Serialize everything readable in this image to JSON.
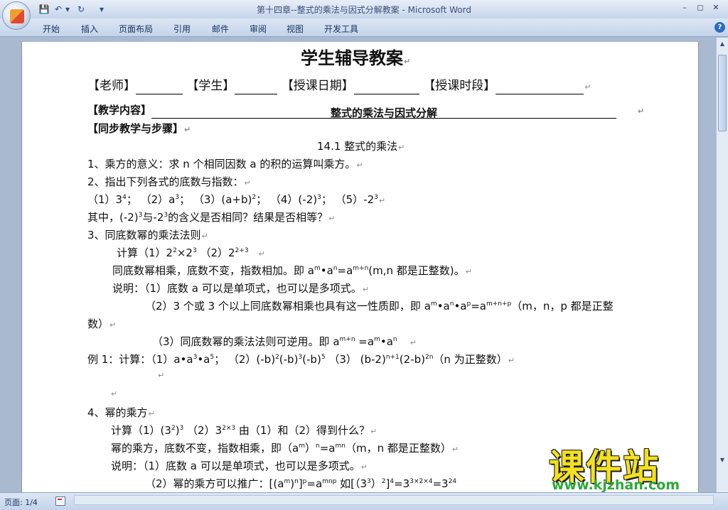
{
  "window": {
    "title": "第十四章--整式的乘法与因式分解教案 - Microsoft Word",
    "minimize": "–",
    "restore": "◻",
    "close": "✕"
  },
  "quick_access": {
    "save_icon": "💾",
    "undo_icon": "↶",
    "undo_dropdown": "▾",
    "redo_icon": "↻",
    "customize_icon": "▾"
  },
  "ribbon": {
    "tabs": [
      "开始",
      "插入",
      "页面布局",
      "引用",
      "邮件",
      "审阅",
      "视图",
      "开发工具"
    ],
    "help": "?"
  },
  "document": {
    "heading": "学生辅导教案",
    "header_fields": {
      "teacher": "【老师】",
      "student": "【学生】",
      "date": "【授课日期】",
      "period": "【授课时段】"
    },
    "content_label": "【教学内容】",
    "content_title": "整式的乘法与因式分解",
    "sync_label": "【同步教学与步骤】",
    "section_title": "14.1  整式的乘法",
    "para_mark": "↵",
    "lines": {
      "l1": "1、乘方的意义：求 n 个相同因数 a 的积的运算叫乘方。",
      "l2": "2、指出下列各式的底数与指数：",
      "l3_1": "（1）3",
      "l3_1s": "4",
      "l3_2": "；  （2）a",
      "l3_2s": "3",
      "l3_3": "；    （3）(a+b)",
      "l3_3s": "2",
      "l3_4": "；    （4）(-2)",
      "l3_4s": "3",
      "l3_5": "；    （5）-2",
      "l3_5s": "3",
      "l4a": "其中，(-2)",
      "l4as": "3",
      "l4b": "与-2",
      "l4bs": "3",
      "l4c": "的含义是否相同？结果是否相等？",
      "l5": "3、同底数幂的乘法法则",
      "l6a": "计算（1）2",
      "l6as": "2",
      "l6b": "×2",
      "l6bs": "3",
      "l6c": "    （2）2",
      "l6cs": "2+3",
      "l7a": "同底数幂相乘，底数不变，指数相加。即 a",
      "l7as": "m",
      "l7b": "•a",
      "l7bs": "n",
      "l7c": "=a",
      "l7cs": "m+n",
      "l7d": "(m,n 都是正整数)。",
      "l8": "说明：（1）底数 a 可以是单项式，也可以是多项式。",
      "l9a": "（2）3 个或 3 个以上同底数幂相乘也具有这一性质即，即 a",
      "l9as": "m",
      "l9b": "•a",
      "l9bs": "n",
      "l9c": "•a",
      "l9cs": "p",
      "l9d": "=a",
      "l9ds": "m+n+p",
      "l9e": "（m，n，p 都是正整",
      "l10": "数）",
      "l11a": "（3）同底数幂的乘法法则可逆用。即 a",
      "l11as": "m+n",
      "l11b": " =a",
      "l11bs": "m",
      "l11c": "•a",
      "l11cs": "n",
      "l12a": "例 1：计算：（1）a•a",
      "l12as": "3",
      "l12b": "•a",
      "l12bs": "5",
      "l12c": "；  （2）(-b)",
      "l12cs": "2",
      "l12d": "(-b)",
      "l12ds": "3",
      "l12e": "(-b)",
      "l12es": "5",
      "l12f": "  （3）  (b-2)",
      "l12fs": "n+1",
      "l12g": "(2-b)",
      "l12gs": "2n",
      "l12h": "（n 为正整数）",
      "l13": "4、幂的乘方",
      "l14a": "计算（1）(3",
      "l14as": "2",
      "l14b": ")",
      "l14bs": "3",
      "l14c": "    （2）3",
      "l14cs": "2×3",
      "l14d": "   由（1）和（2）得到什么？",
      "l15a": "幂的乘方，底数不变，指数相乘，即（a",
      "l15as": "m",
      "l15b": "）",
      "l15bs": "n",
      "l15c": "=a",
      "l15cs": "mn",
      "l15d": "（m，n 都是正整数）",
      "l16": "说明：（1）底数 a 可以是单项式，也可以是多项式。",
      "l17a": "（2）幂的乘方可以推广：[(a",
      "l17as": "m",
      "l17b": ")",
      "l17bs": "n",
      "l17c": "]",
      "l17cs": "p",
      "l17d": "=a",
      "l17ds": "mnp",
      "l17e": "   如[（3",
      "l17es": "3",
      "l17f": "）",
      "l17fs": "2",
      "l17g": "]",
      "l17gs": "4",
      "l17h": "=3",
      "l17hs": "3×2×4",
      "l17i": "=3",
      "l17is": "24"
    }
  },
  "status": {
    "page": "页面: 1/4"
  },
  "watermark": {
    "big": "课件站",
    "url": "www.kjzhan.com"
  },
  "colors": {
    "watermark_yellow": "#f3e11f",
    "watermark_green": "#2fa83a",
    "ribbon_blue": "#c3d4ea"
  }
}
